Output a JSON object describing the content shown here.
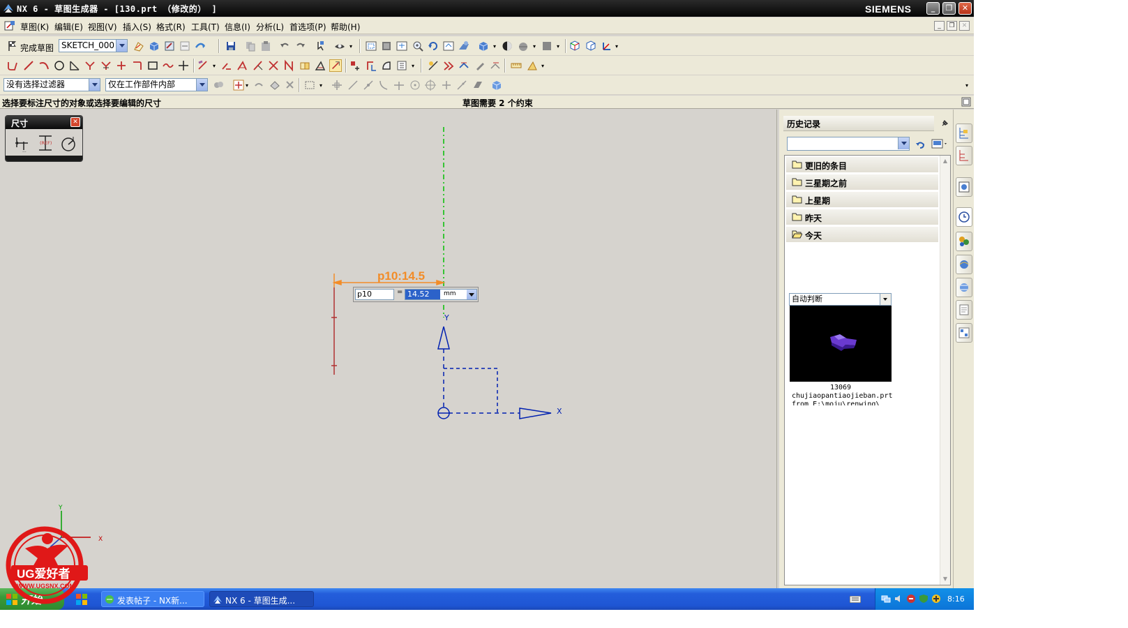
{
  "window": {
    "title": "NX 6 - 草图生成器 - [130.prt （修改的） ]",
    "brand": "SIEMENS"
  },
  "menu": {
    "items": [
      "草图(K)",
      "编辑(E)",
      "视图(V)",
      "插入(S)",
      "格式(R)",
      "工具(T)",
      "信息(I)",
      "分析(L)",
      "首选项(P)",
      "帮助(H)"
    ]
  },
  "toolbar": {
    "finish_sketch_label": "完成草图",
    "sketch_name": "SKETCH_000",
    "selection_filter": "没有选择过滤器",
    "selection_scope": "仅在工作部件内部"
  },
  "statusline": {
    "cue": "选择要标注尺寸的对象或选择要编辑的尺寸",
    "status": "草图需要 2 个约束"
  },
  "dimension_palette": {
    "title": "尺寸"
  },
  "sketch": {
    "dimension_label": "p10:14.5",
    "axis_x": "X",
    "axis_y": "Y",
    "accent_orange": "#f28c28",
    "axis_green": "#00c000",
    "datum_blue": "#0020b0",
    "curve_red": "#b03030"
  },
  "dimension_input": {
    "name": "p10",
    "equals": "=",
    "value": "14.52",
    "unit": "mm"
  },
  "history": {
    "title": "历史记录",
    "groups": [
      "更旧的条目",
      "三星期之前",
      "上星期",
      "昨天",
      "今天"
    ],
    "preview_mode": "自动判断",
    "item_id": "13069",
    "item_name": "chujiaopantiaojieban.prt",
    "item_from": "from E:\\moju\\renwing\\"
  },
  "taskbar": {
    "start": "开始",
    "tasks": [
      "发表帖子 - NX新...",
      "NX 6 - 草图生成..."
    ],
    "clock": "8:16"
  },
  "watermark": {
    "text": "UG爱好者",
    "url": "WWW.UGSNX.COM"
  }
}
